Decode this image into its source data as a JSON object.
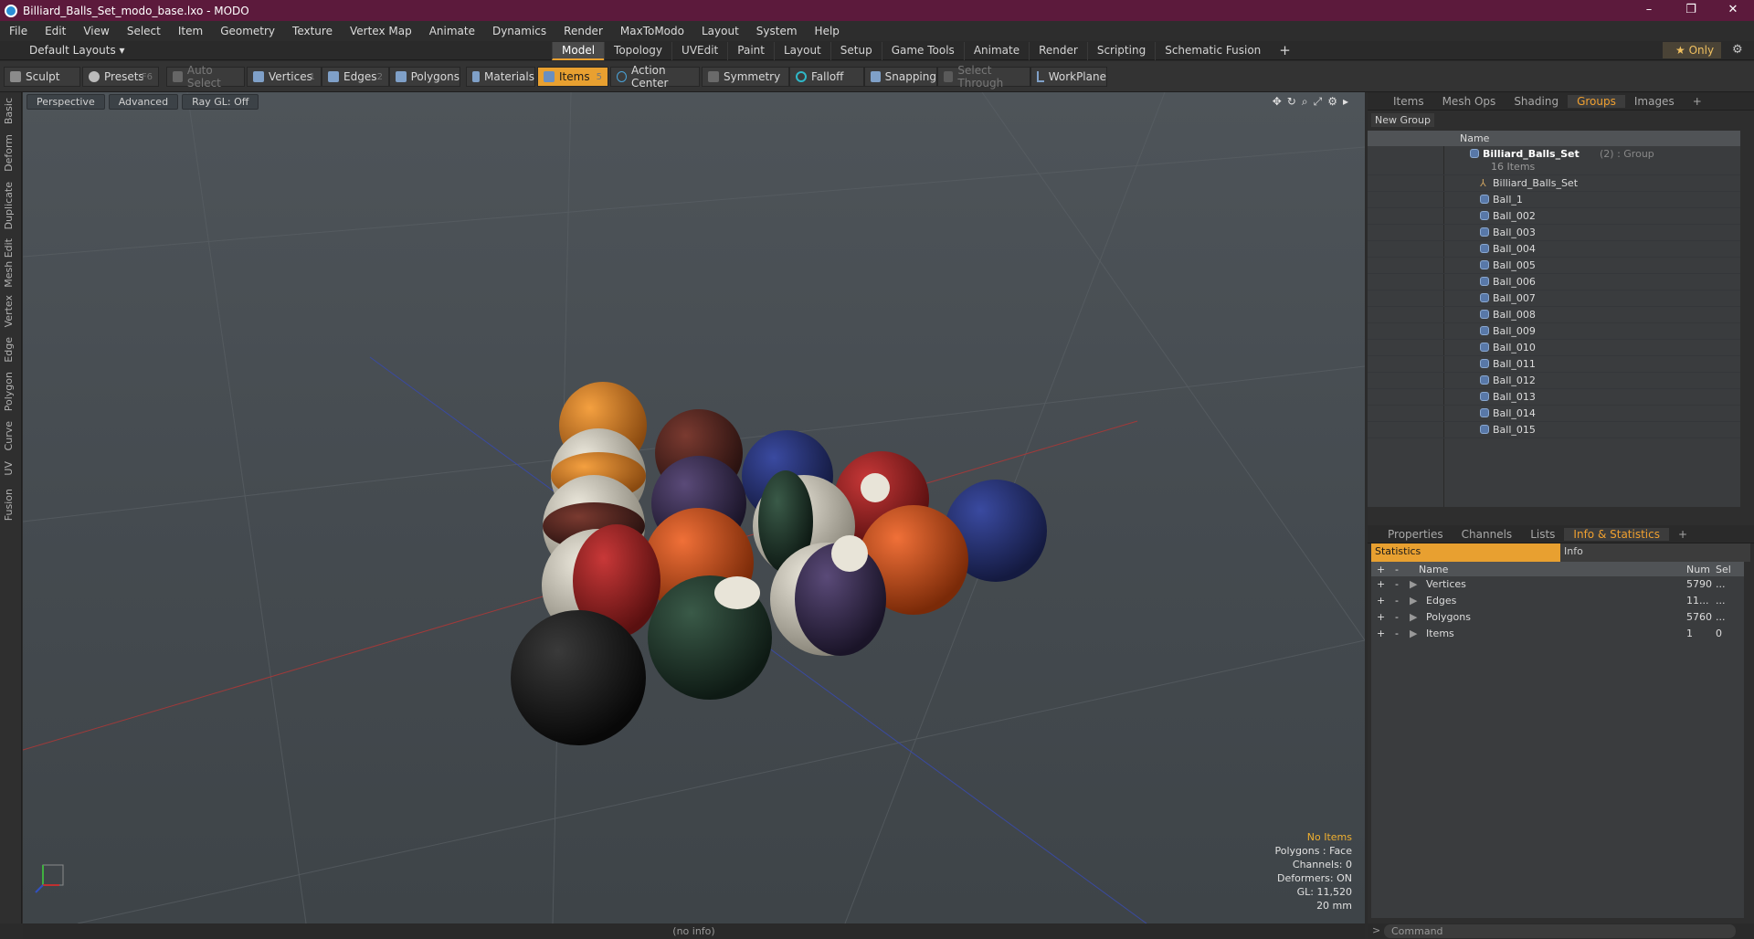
{
  "window": {
    "title": "Billiard_Balls_Set_modo_base.lxo - MODO",
    "controls": [
      "–",
      "❐",
      "✕"
    ]
  },
  "menu": [
    "File",
    "Edit",
    "View",
    "Select",
    "Item",
    "Geometry",
    "Texture",
    "Vertex Map",
    "Animate",
    "Dynamics",
    "Render",
    "MaxToModo",
    "Layout",
    "System",
    "Help"
  ],
  "layouts": {
    "default_label": "Default Layouts ▾",
    "tabs": [
      "Model",
      "Topology",
      "UVEdit",
      "Paint",
      "Layout",
      "Setup",
      "Game Tools",
      "Animate",
      "Render",
      "Scripting",
      "Schematic Fusion"
    ],
    "active": "Model",
    "plus": "+",
    "only": "★  Only",
    "gear": "⚙"
  },
  "toolbar": {
    "sculpt": "Sculpt",
    "presets": "Presets",
    "presets_key": "F6",
    "auto_select": "Auto Select",
    "vertices": "Vertices",
    "vertices_key": "1",
    "edges": "Edges",
    "edges_key": "2",
    "polygons": "Polygons",
    "materials": "Materials",
    "items": "Items",
    "items_key": "5",
    "action_center": "Action Center",
    "symmetry": "Symmetry",
    "falloff": "Falloff",
    "snapping": "Snapping",
    "select_through": "Select Through",
    "workplane": "WorkPlane"
  },
  "left_tabs": [
    "Basic",
    "Deform",
    "Duplicate",
    "Mesh Edit",
    "Vertex",
    "Edge",
    "Polygon",
    "Curve",
    "UV",
    "Fusion"
  ],
  "viewport": {
    "view": "Perspective",
    "shading": "Advanced",
    "raygl": "Ray GL: Off",
    "info": {
      "items": "No Items",
      "polygons": "Polygons : Face",
      "channels": "Channels: 0",
      "deformers": "Deformers: ON",
      "gl": "GL: 11,520",
      "scale": "20 mm"
    },
    "status": "(no info)"
  },
  "scene_panel": {
    "tabs": [
      "Items",
      "Mesh Ops",
      "Shading",
      "Groups",
      "Images",
      "+"
    ],
    "active": "Groups",
    "new_group": "New Group",
    "name_header": "Name",
    "group_name": "Billiard_Balls_Set",
    "group_suffix": "(2) : Group",
    "group_count": "16 Items",
    "locator": "Billiard_Balls_Set",
    "items": [
      "Ball_1",
      "Ball_002",
      "Ball_003",
      "Ball_004",
      "Ball_005",
      "Ball_006",
      "Ball_007",
      "Ball_008",
      "Ball_009",
      "Ball_010",
      "Ball_011",
      "Ball_012",
      "Ball_013",
      "Ball_014",
      "Ball_015"
    ]
  },
  "stats_panel": {
    "tabs": [
      "Properties",
      "Channels",
      "Lists",
      "Info & Statistics",
      "+"
    ],
    "active": "Info & Statistics",
    "subtab_stats": "Statistics",
    "subtab_info": "Info",
    "headers": {
      "name": "Name",
      "num": "Num",
      "sel": "Sel"
    },
    "rows": [
      {
        "name": "Vertices",
        "num": "5790",
        "sel": "..."
      },
      {
        "name": "Edges",
        "num": "11...",
        "sel": "..."
      },
      {
        "name": "Polygons",
        "num": "5760",
        "sel": "..."
      },
      {
        "name": "Items",
        "num": "1",
        "sel": "0"
      }
    ]
  },
  "command": {
    "placeholder": "Command"
  }
}
